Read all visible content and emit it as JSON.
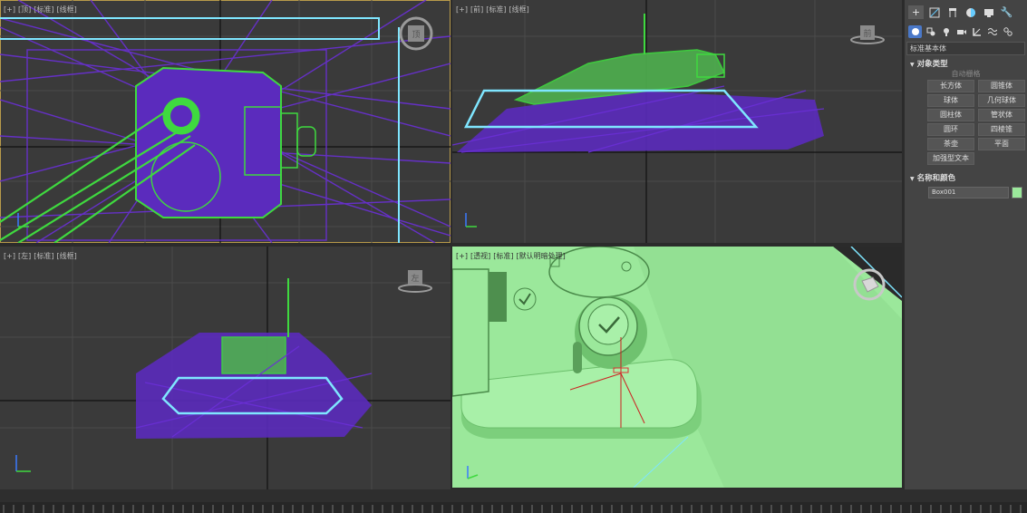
{
  "viewports": {
    "top": {
      "tags": [
        "[+]",
        "[顶]",
        "[标准]",
        "[线框]"
      ],
      "cube_label": "顶"
    },
    "front": {
      "tags": [
        "[+]",
        "[前]",
        "[标准]",
        "[线框]"
      ],
      "cube_label": "前"
    },
    "left": {
      "tags": [
        "[+]",
        "[左]",
        "[标准]",
        "[线框]"
      ],
      "cube_label": "左"
    },
    "perspective": {
      "tags": [
        "[+]",
        "[透视]",
        "[标准]",
        "[默认明暗处理]"
      ]
    }
  },
  "panel": {
    "tabs": [
      "create-icon",
      "modify-icon",
      "hierarchy-icon",
      "motion-icon",
      "display-icon",
      "utilities-icon"
    ],
    "subtabs": [
      "geometry-icon",
      "shapes-icon",
      "lights-icon",
      "cameras-icon",
      "helpers-icon",
      "spacewarps-icon",
      "systems-icon"
    ],
    "category": "标准基本体",
    "object_type_title": "对象类型",
    "autogrid": "自动栅格",
    "object_buttons": [
      "长方体",
      "圆锥体",
      "球体",
      "几何球体",
      "圆柱体",
      "管状体",
      "圆环",
      "四棱锥",
      "茶壶",
      "平面",
      "加强型文本"
    ],
    "name_color_title": "名称和颜色",
    "object_name": "Box001",
    "object_color": "#9be89b"
  },
  "colors": {
    "wire_purple": "#6a2fd6",
    "wire_green": "#3fd93f",
    "highlight_cyan": "#7fe6ff",
    "shaded_green": "#9be89b"
  }
}
